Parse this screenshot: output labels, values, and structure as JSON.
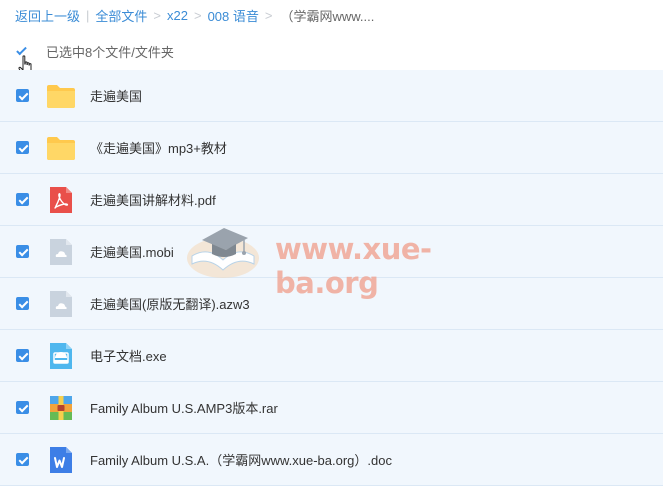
{
  "breadcrumb": {
    "back": "返回上一级",
    "all_files": "全部文件",
    "folder1": "x22",
    "folder2": "008 语音",
    "current": "（学霸网www....",
    "separator_main": "|",
    "separator": ">"
  },
  "selection": {
    "label": "已选中8个文件/文件夹",
    "checked": true
  },
  "files": [
    {
      "name": "走遍美国",
      "icon": "folder-icon",
      "checked": true
    },
    {
      "name": "《走遍美国》mp3+教材",
      "icon": "folder-icon",
      "checked": true
    },
    {
      "name": "走遍美国讲解材料.pdf",
      "icon": "pdf-icon",
      "checked": true
    },
    {
      "name": "走遍美国.mobi",
      "icon": "ebook-icon",
      "checked": true
    },
    {
      "name": "走遍美国(原版无翻译).azw3",
      "icon": "ebook-icon",
      "checked": true
    },
    {
      "name": "电子文档.exe",
      "icon": "exe-icon",
      "checked": true
    },
    {
      "name": "Family Album U.S.AMP3版本.rar",
      "icon": "rar-icon",
      "checked": true
    },
    {
      "name": "Family Album U.S.A.（学霸网www.xue-ba.org）.doc",
      "icon": "word-icon",
      "checked": true
    }
  ],
  "watermark": {
    "text": "www.xue-ba.org",
    "icon": "graduation-cap-icon"
  },
  "colors": {
    "accent": "#3a8ee6",
    "link": "#3b8cd6",
    "row_bg": "#f1f7fd",
    "folder": "#ffc94d",
    "pdf": "#e9504a",
    "word": "#3d7ee6",
    "watermark": "#f0a898"
  }
}
